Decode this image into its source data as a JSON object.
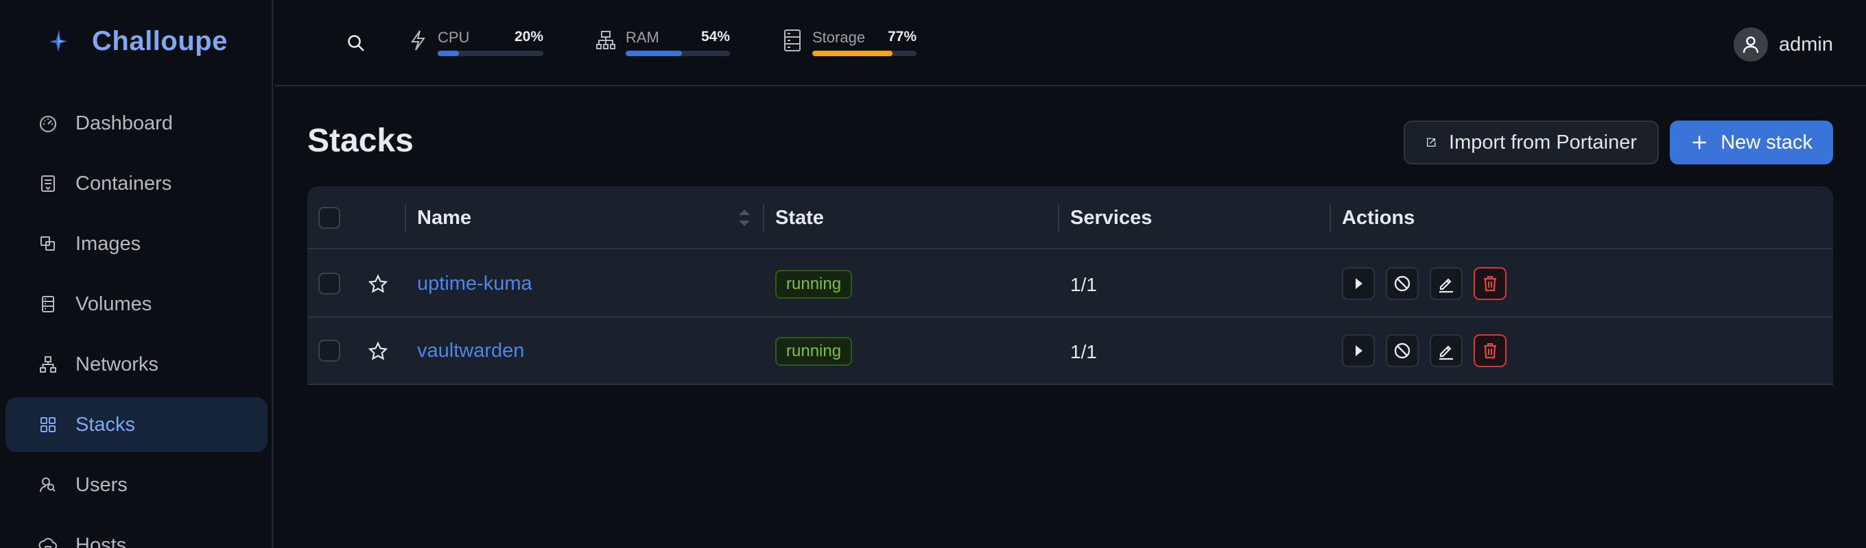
{
  "app": {
    "name": "Challoupe",
    "accent": "#7fa8f0",
    "icon": "sparkle-logo-icon"
  },
  "sidebar": {
    "items": [
      {
        "label": "Dashboard",
        "icon": "gauge-icon",
        "active": false
      },
      {
        "label": "Containers",
        "icon": "container-icon",
        "active": false
      },
      {
        "label": "Images",
        "icon": "images-icon",
        "active": false
      },
      {
        "label": "Volumes",
        "icon": "volume-icon",
        "active": false
      },
      {
        "label": "Networks",
        "icon": "network-icon",
        "active": false
      },
      {
        "label": "Stacks",
        "icon": "grid-icon",
        "active": true
      },
      {
        "label": "Users",
        "icon": "users-icon",
        "active": false
      },
      {
        "label": "Hosts",
        "icon": "hosts-icon",
        "active": false
      }
    ]
  },
  "header": {
    "metrics": [
      {
        "label": "CPU",
        "value": "20%",
        "percent": 20,
        "color": "#3b74d9",
        "icon": "bolt-icon"
      },
      {
        "label": "RAM",
        "value": "54%",
        "percent": 54,
        "color": "#3b74d9",
        "icon": "memory-icon"
      },
      {
        "label": "Storage",
        "value": "77%",
        "percent": 77,
        "color": "#f2a51c",
        "icon": "storage-icon"
      }
    ],
    "user": {
      "name": "admin"
    }
  },
  "main": {
    "title": "Stacks",
    "import_button": "Import from Portainer",
    "new_button": "New stack",
    "table": {
      "columns": {
        "name": "Name",
        "state": "State",
        "services": "Services",
        "actions": "Actions"
      },
      "rows": [
        {
          "name": "uptime-kuma",
          "state": "running",
          "services": "1/1"
        },
        {
          "name": "vaultwarden",
          "state": "running",
          "services": "1/1"
        }
      ]
    }
  }
}
